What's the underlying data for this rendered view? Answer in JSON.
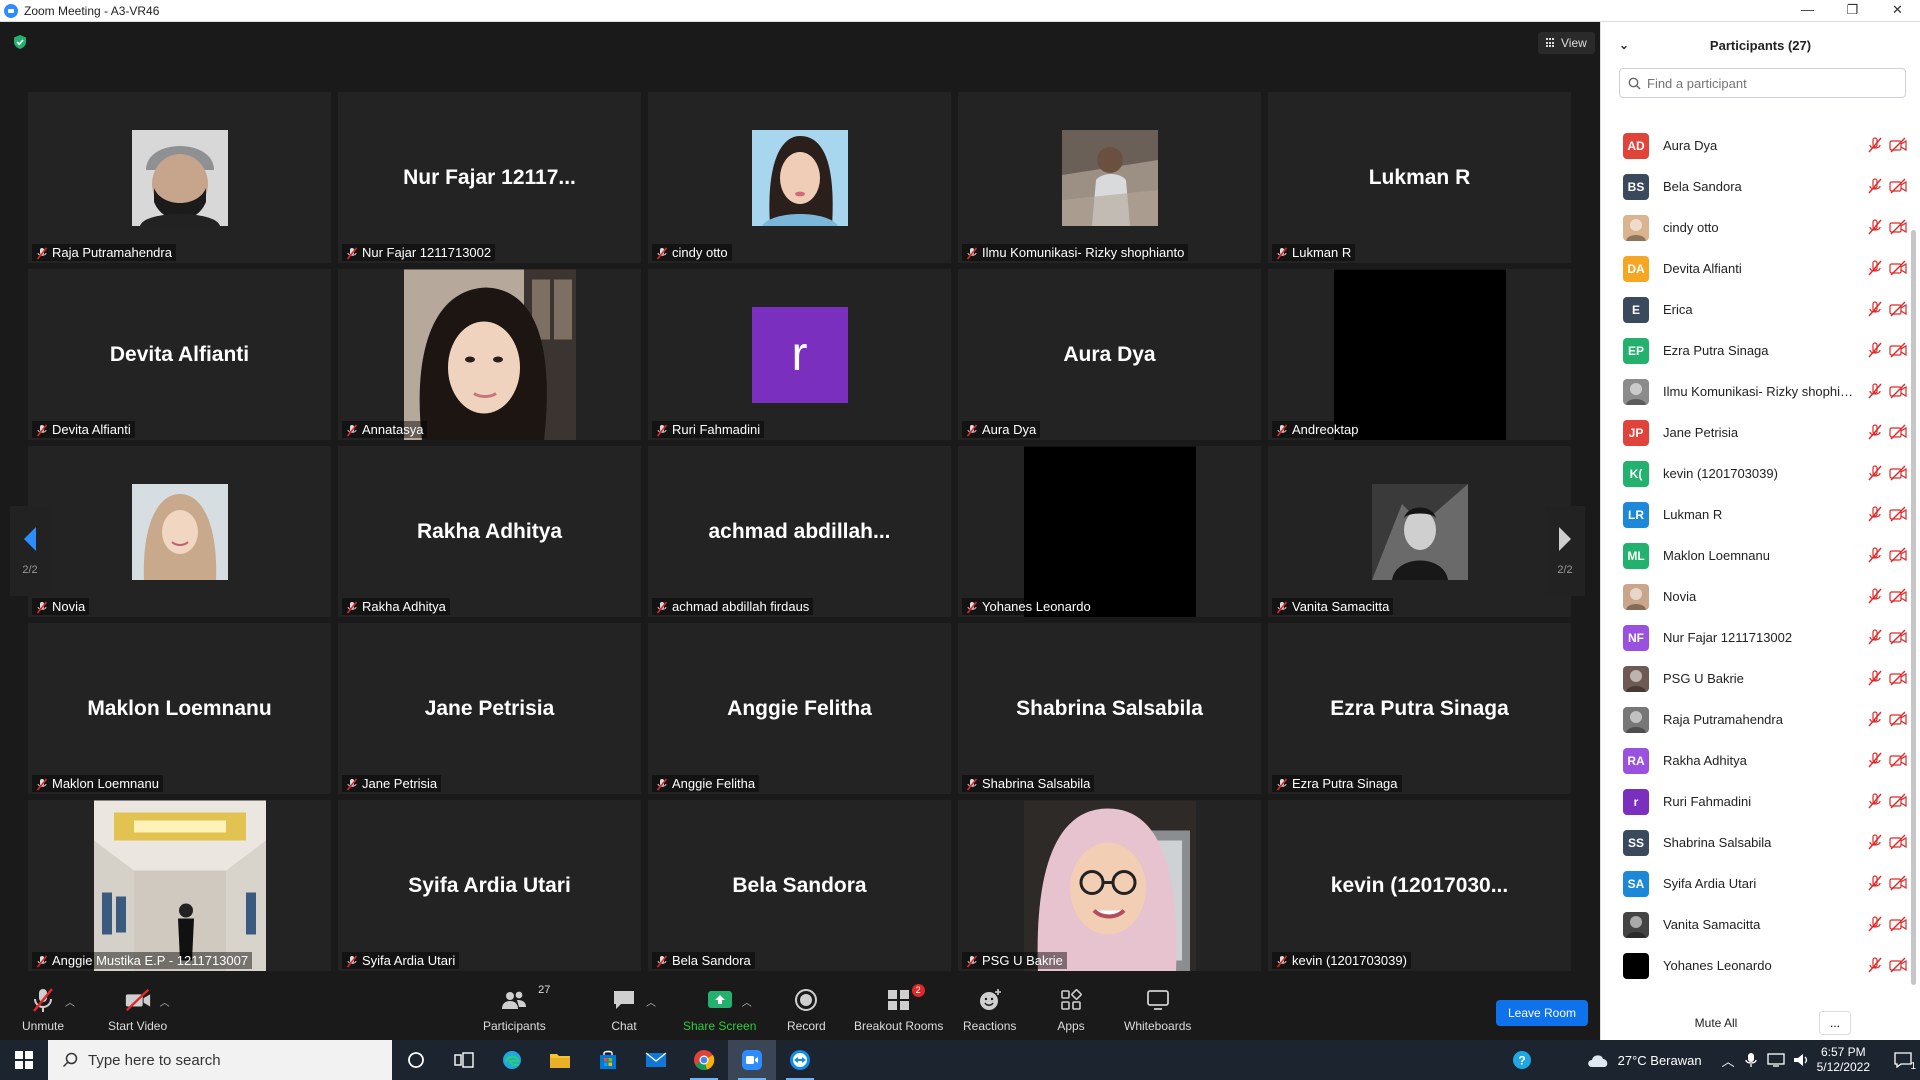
{
  "window": {
    "title": "Zoom Meeting - A3-VR46",
    "controls": [
      "—",
      "❐",
      "✕"
    ]
  },
  "view_button": {
    "label": "View"
  },
  "pager": {
    "left_label": "2/2",
    "right_label": "2/2"
  },
  "tiles": [
    {
      "type": "photo",
      "photo": "masked-man",
      "label": "Raja Putramahendra"
    },
    {
      "type": "name",
      "display": "Nur Fajar 12117...",
      "label": "Nur Fajar 1211713002"
    },
    {
      "type": "photo",
      "photo": "girl-selfie",
      "label": "cindy otto"
    },
    {
      "type": "photo",
      "photo": "man-outdoor",
      "label": "Ilmu Komunikasi- Rizky shophianto"
    },
    {
      "type": "name",
      "display": "Lukman R",
      "label": "Lukman R"
    },
    {
      "type": "name",
      "display": "Devita Alfianti",
      "label": "Devita Alfianti"
    },
    {
      "type": "video",
      "photo": "annatasya-video",
      "label": "Annatasya"
    },
    {
      "type": "letter",
      "display": "r",
      "label": "Ruri Fahmadini"
    },
    {
      "type": "name",
      "display": "Aura Dya",
      "label": "Aura Dya"
    },
    {
      "type": "black",
      "label": "Andreoktap"
    },
    {
      "type": "photo",
      "photo": "hijab-girl",
      "label": "Novia"
    },
    {
      "type": "name",
      "display": "Rakha Adhitya",
      "label": "Rakha Adhitya"
    },
    {
      "type": "name",
      "display": "achmad  abdillah...",
      "label": "achmad abdillah firdaus"
    },
    {
      "type": "black",
      "label": "Yohanes Leonardo"
    },
    {
      "type": "photo",
      "photo": "bw-portrait",
      "label": "Vanita Samacitta"
    },
    {
      "type": "name",
      "display": "Maklon Loemnanu",
      "label": "Maklon Loemnanu"
    },
    {
      "type": "name",
      "display": "Jane Petrisia",
      "label": "Jane Petrisia"
    },
    {
      "type": "name",
      "display": "Anggie Felitha",
      "label": "Anggie Felitha"
    },
    {
      "type": "name",
      "display": "Shabrina Salsabila",
      "label": "Shabrina Salsabila"
    },
    {
      "type": "name",
      "display": "Ezra Putra Sinaga",
      "label": "Ezra Putra Sinaga"
    },
    {
      "type": "video",
      "photo": "hallway-video",
      "label": "Anggie Mustika E.P - 1211713007"
    },
    {
      "type": "name",
      "display": "Syifa Ardia Utari",
      "label": "Syifa Ardia Utari"
    },
    {
      "type": "name",
      "display": "Bela Sandora",
      "label": "Bela Sandora"
    },
    {
      "type": "video",
      "photo": "hijab-woman-video",
      "label": "PSG U Bakrie"
    },
    {
      "type": "name",
      "display": "kevin  (12017030...",
      "label": "kevin (1201703039)"
    }
  ],
  "toolbar": {
    "unmute": "Unmute",
    "start_video": "Start Video",
    "participants": "Participants",
    "participants_count": "27",
    "chat": "Chat",
    "share_screen": "Share Screen",
    "record": "Record",
    "breakout_rooms": "Breakout Rooms",
    "breakout_badge": "2",
    "reactions": "Reactions",
    "apps": "Apps",
    "whiteboards": "Whiteboards",
    "leave": "Leave Room"
  },
  "panel": {
    "title": "Participants (27)",
    "search_placeholder": "Find a participant",
    "mute_all": "Mute All",
    "more": "...",
    "participants": [
      {
        "initials": "AD",
        "color": "#e0433a",
        "name": "Aura Dya"
      },
      {
        "initials": "BS",
        "color": "#3a4a5c",
        "name": "Bela Sandora"
      },
      {
        "initials": "",
        "color": "#d9b48f",
        "name": "cindy otto",
        "photo": true
      },
      {
        "initials": "DA",
        "color": "#f5a623",
        "name": "Devita Alfianti"
      },
      {
        "initials": "E",
        "color": "#3a4a5c",
        "name": "Erica"
      },
      {
        "initials": "EP",
        "color": "#23b26d",
        "name": "Ezra Putra Sinaga"
      },
      {
        "initials": "",
        "color": "#8c8c8c",
        "name": "Ilmu Komunikasi- Rizky shophia...",
        "photo": true
      },
      {
        "initials": "JP",
        "color": "#e0433a",
        "name": "Jane Petrisia"
      },
      {
        "initials": "K(",
        "color": "#23b26d",
        "name": "kevin (1201703039)"
      },
      {
        "initials": "LR",
        "color": "#1e88d8",
        "name": "Lukman R"
      },
      {
        "initials": "ML",
        "color": "#23b26d",
        "name": "Maklon Loemnanu"
      },
      {
        "initials": "",
        "color": "#c9a58a",
        "name": "Novia",
        "photo": true
      },
      {
        "initials": "NF",
        "color": "#9b51e0",
        "name": "Nur Fajar 1211713002"
      },
      {
        "initials": "",
        "color": "#6d5a52",
        "name": "PSG U Bakrie",
        "photo": true
      },
      {
        "initials": "",
        "color": "#777777",
        "name": "Raja Putramahendra",
        "photo": true
      },
      {
        "initials": "RA",
        "color": "#9b51e0",
        "name": "Rakha Adhitya"
      },
      {
        "initials": "r",
        "color": "#7b2fbe",
        "name": "Ruri Fahmadini"
      },
      {
        "initials": "SS",
        "color": "#3a4a5c",
        "name": "Shabrina Salsabila"
      },
      {
        "initials": "SA",
        "color": "#1e88d8",
        "name": "Syifa Ardia Utari"
      },
      {
        "initials": "",
        "color": "#444444",
        "name": "Vanita Samacitta",
        "photo": true
      },
      {
        "initials": "",
        "color": "#000000",
        "name": "Yohanes Leonardo"
      }
    ]
  },
  "taskbar": {
    "search_placeholder": "Type here to search",
    "weather": "27°C  Berawan",
    "time": "6:57 PM",
    "date": "5/12/2022",
    "notif_count": "1"
  },
  "colors": {
    "accent": "#0e72ed",
    "muted_red": "#e02828",
    "green": "#2ecc40"
  }
}
